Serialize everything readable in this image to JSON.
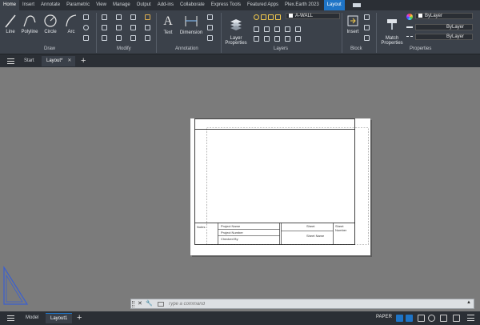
{
  "menu": {
    "tabs": [
      "Home",
      "Insert",
      "Annotate",
      "Parametric",
      "View",
      "Manage",
      "Output",
      "Add-ins",
      "Collaborate",
      "Express Tools",
      "Featured Apps",
      "Plex.Earth 2023"
    ],
    "active_tab": "Layout"
  },
  "ribbon": {
    "draw": {
      "line": "Line",
      "polyline": "Polyline",
      "circle": "Circle",
      "arc": "Arc",
      "label": "Draw"
    },
    "modify": {
      "label": "Modify"
    },
    "annotation": {
      "text": "Text",
      "dimension": "Dimension",
      "label": "Annotation"
    },
    "layers": {
      "layer_properties": "Layer\nProperties",
      "current_layer": "A-WALL",
      "label": "Layers"
    },
    "block": {
      "insert": "Insert",
      "label": "Block"
    },
    "properties": {
      "match": "Match\nProperties",
      "color": "ByLayer",
      "linetype": "ByLayer",
      "lineweight": "ByLayer",
      "label": "Properties"
    }
  },
  "tabs": {
    "start": "Start",
    "layout": "Layout*"
  },
  "titleblock": {
    "notes": "Notes",
    "project_name": "Project Name",
    "project_number": "Project Number",
    "checked_by": "Checked By",
    "sheet": "Sheet",
    "sheet_number": "Sheet Number",
    "sheet_name": "Sheet Name"
  },
  "command": {
    "placeholder": "Type a command"
  },
  "status": {
    "model": "Model",
    "layout1": "Layout1",
    "paper": "PAPER"
  },
  "colors": {
    "accent": "#1e74c6",
    "ribbon": "#3b414a",
    "bar": "#2b2f35",
    "canvas": "#7b7b7b"
  }
}
